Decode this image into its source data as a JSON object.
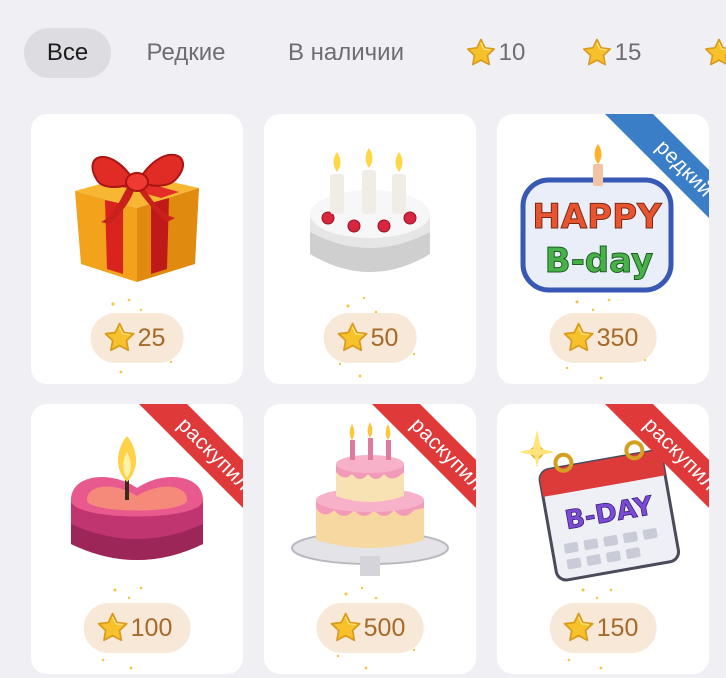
{
  "tabs": [
    {
      "label": "Все",
      "active": true
    },
    {
      "label": "Редкие",
      "active": false
    },
    {
      "label": "В наличии",
      "active": false
    },
    {
      "label": "10",
      "icon": "star-icon",
      "active": false
    },
    {
      "label": "15",
      "icon": "star-icon",
      "active": false
    }
  ],
  "gifts": [
    {
      "name": "gift-box",
      "price": "25",
      "ribbon": ""
    },
    {
      "name": "birthday-cake",
      "price": "50",
      "ribbon": ""
    },
    {
      "name": "happy-bday-sign",
      "price": "350",
      "ribbon": "редкий"
    },
    {
      "name": "heart-candle",
      "price": "100",
      "ribbon": "раскупили"
    },
    {
      "name": "tiered-cake",
      "price": "500",
      "ribbon": "раскупили"
    },
    {
      "name": "bday-calendar",
      "price": "150",
      "ribbon": "раскупили"
    }
  ],
  "art_text": {
    "happy": "HAPPY",
    "bday": "B-day",
    "calendar": "B-DAY"
  },
  "colors": {
    "background": "#efeff4",
    "card": "#ffffff",
    "price_pill": "#f7e8d8",
    "price_text": "#a56a2a",
    "ribbon_rare": "#3a7ec8",
    "ribbon_sold": "#e0393a",
    "star": "#f6c12a"
  }
}
